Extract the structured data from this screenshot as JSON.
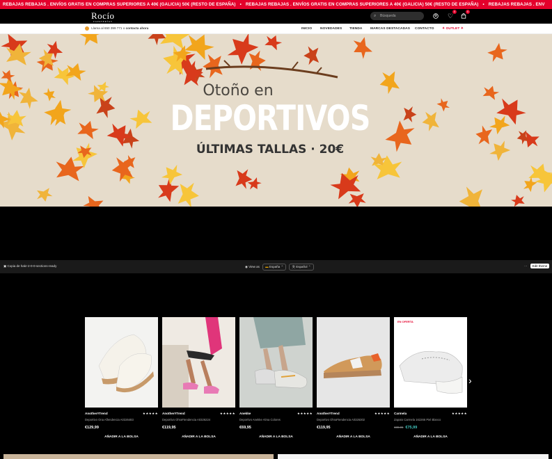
{
  "promo": {
    "text_1": "REBAJAS REBAJAS . ENVÍOS GRATIS EN COMPRAS SUPERIORES A 40€ (GALICIA) 50€ (RESTO DE ESPAÑA)",
    "separator": "•",
    "text_2": "REBAJAS REBAJAS . ENVÍOS GRATIS EN COMPRAS SUPERIORES A 40€ (GALICIA) 50€ (RESTO DE ESPAÑA)",
    "text_3": "REBAJAS REBAJAS . ENV"
  },
  "header": {
    "logo": "Rocío",
    "logo_sub": "ZAPATERÍAS",
    "search_placeholder": "Búsqueda",
    "wishlist_count": "0",
    "cart_count": "0"
  },
  "nav": {
    "phone_prefix": "Llama al 650 399 771 o",
    "phone_link": "contacta ahora",
    "items": [
      "INICIO",
      "NOVEDADES",
      "TIENDA",
      "MARCAS DESTACADAS",
      "CONTACTO"
    ],
    "outlet": "OUTLET"
  },
  "hero": {
    "line1": "Otoño en",
    "line2": "DEPORTIVOS",
    "line3": "ÚLTIMAS TALLAS · 20€"
  },
  "editor_bar": {
    "left_text": "Copia de hakr-2-0-0-sections-ready",
    "view_as": "View as",
    "country": "España",
    "language": "Español",
    "more": "···",
    "edit_button": "Edit theme"
  },
  "products": [
    {
      "brand": "Another#Trend",
      "stars": "★★★★★",
      "name": "Deportivo Ona Aflendencia A0326483",
      "price": "€129,99",
      "old_price": "",
      "sale_tag": "",
      "add": "AÑADIR A LA BOLSA"
    },
    {
      "brand": "Another#Trend",
      "stars": "★★★★★",
      "name": "Deportivo OhraFtendencia A0326224",
      "price": "€119,95",
      "old_price": "",
      "sale_tag": "",
      "add": "AÑADIR A LA BOLSA"
    },
    {
      "brand": "Anekke",
      "stars": "★★★★★",
      "name": "Deportivo Anekke Alma Colores",
      "price": "€69,95",
      "old_price": "",
      "sale_tag": "",
      "add": "AÑADIR A LA BOLSA"
    },
    {
      "brand": "Another#Trend",
      "stars": "★★★★★",
      "name": "Deportivo OhraFtendencia A0326302",
      "price": "€119,95",
      "old_price": "",
      "sale_tag": "",
      "add": "AÑADIR A LA BOLSA"
    },
    {
      "brand": "Carmela",
      "stars": "★★★★★",
      "name": "Zapato Carmela 162266 Piel Blanco",
      "price": "€75,99",
      "old_price": "€89,95",
      "sale_tag": "EN OFERTA",
      "add": "AÑADIR A LA BOLSA"
    }
  ]
}
